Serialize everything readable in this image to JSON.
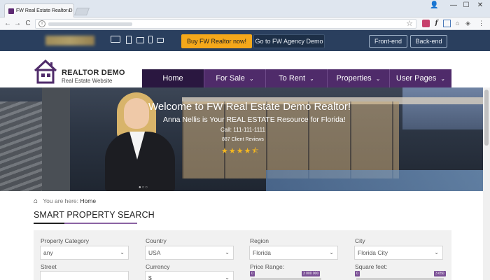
{
  "browser": {
    "tab_title": "FW Real Estate Realtor D",
    "tab_close": "×",
    "window_controls": [
      "—",
      "☐",
      "✕"
    ],
    "nav": {
      "back": "←",
      "forward": "→",
      "reload": "C"
    },
    "url_info": "i",
    "star": "☆",
    "extensions": [
      "⋮"
    ]
  },
  "topbar": {
    "cta_primary": "Buy FW Realtor now!",
    "cta_secondary": "Go to FW Agency Demo",
    "frontend": "Front-end",
    "backend": "Back-end"
  },
  "header": {
    "brand_title": "REALTOR DEMO",
    "brand_subtitle": "Real Estate Website",
    "nav": [
      {
        "label": "Home",
        "chevron": ""
      },
      {
        "label": "For Sale",
        "chevron": "⌄"
      },
      {
        "label": "To Rent",
        "chevron": "⌄"
      },
      {
        "label": "Properties",
        "chevron": "⌄"
      },
      {
        "label": "User Pages",
        "chevron": "⌄"
      }
    ]
  },
  "hero": {
    "title": "Welcome to FW Real Estate Demo Realtor!",
    "subtitle": "Anna Nellis is Your REAL ESTATE Resource for Florida!",
    "call": "Call: 111-111-1111",
    "reviews": "887 Client Reviews",
    "rating": 4.5,
    "stars": "★★★★⯪",
    "dots": "●○○"
  },
  "breadcrumb": {
    "prefix": "You are here:",
    "current": "Home"
  },
  "search": {
    "title": "SMART PROPERTY SEARCH",
    "fields": {
      "property_category": {
        "label": "Property Category",
        "value": "any"
      },
      "country": {
        "label": "Country",
        "value": "USA"
      },
      "region": {
        "label": "Region",
        "value": "Florida"
      },
      "city": {
        "label": "City",
        "value": "Florida City"
      },
      "street": {
        "label": "Street",
        "value": ""
      },
      "currency": {
        "label": "Currency",
        "value": "$"
      },
      "price_range": {
        "label": "Price Range:",
        "min": "0",
        "max": "3 000 000"
      },
      "square_feet": {
        "label": "Square feet:",
        "min": "0",
        "max": "3 650"
      }
    }
  },
  "colors": {
    "accent_purple": "#4f2b6a",
    "active_nav": "#2a1740",
    "topbar": "#2a3f5e",
    "cta_yellow": "#f5a81a",
    "star": "#f5b81f"
  }
}
